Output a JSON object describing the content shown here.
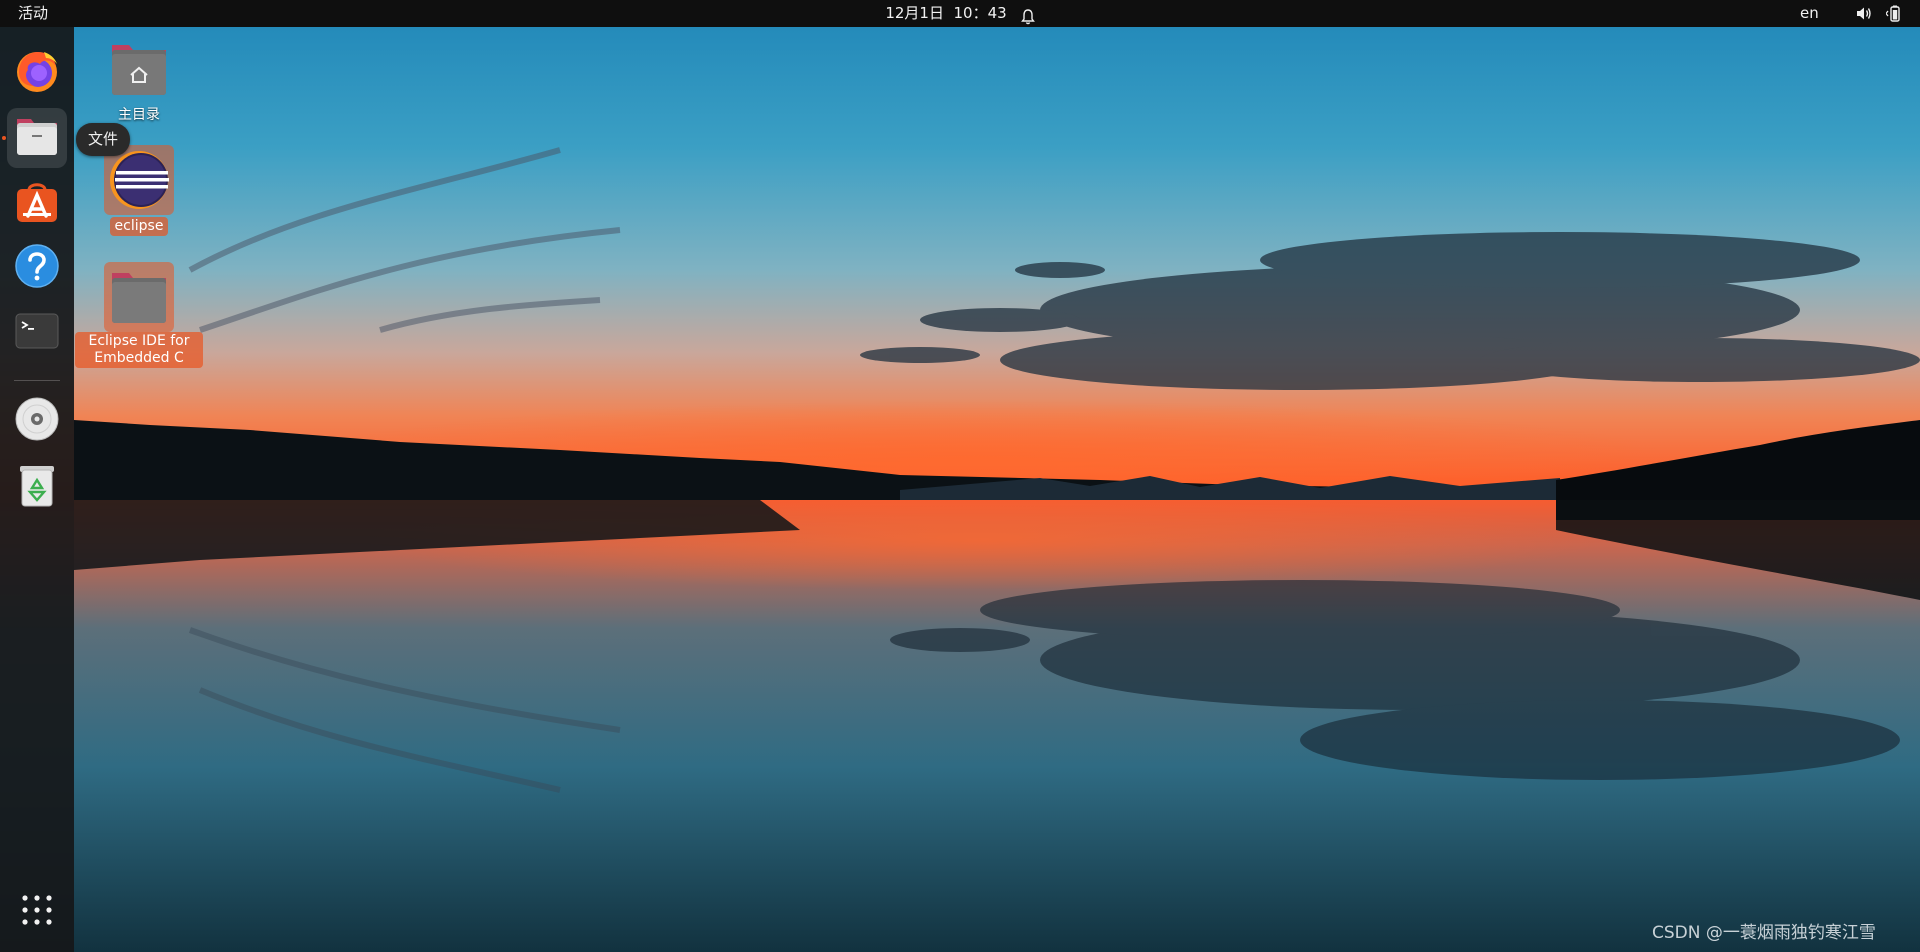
{
  "topbar": {
    "activities": "活动",
    "clock": "12月1日  10：43",
    "language": "en",
    "icons": [
      "bell-icon",
      "speaker-icon",
      "battery-icon"
    ]
  },
  "dock": {
    "items": [
      {
        "name": "firefox",
        "icon": "firefox-icon"
      },
      {
        "name": "files",
        "icon": "files-icon",
        "active": true
      },
      {
        "name": "software",
        "icon": "app-center-icon"
      },
      {
        "name": "help",
        "icon": "help-icon"
      },
      {
        "name": "terminal",
        "icon": "terminal-icon"
      },
      {
        "name": "disc",
        "icon": "disc-icon"
      },
      {
        "name": "trash",
        "icon": "trash-icon"
      },
      {
        "name": "show-apps",
        "icon": "grid-icon"
      }
    ],
    "tooltip": "文件"
  },
  "desktop": {
    "icons": [
      {
        "label": "主目录",
        "icon": "home-folder-icon"
      },
      {
        "label": "eclipse",
        "icon": "eclipse-icon",
        "selected": true
      },
      {
        "label": "Eclipse IDE for Embedded C",
        "icon": "folder-icon",
        "selected": true
      }
    ]
  },
  "watermark": "CSDN @一蓑烟雨独钓寒江雪",
  "colors": {
    "accent": "#e95420",
    "topbar": "#0f0f0f",
    "dock": "#16181a"
  }
}
